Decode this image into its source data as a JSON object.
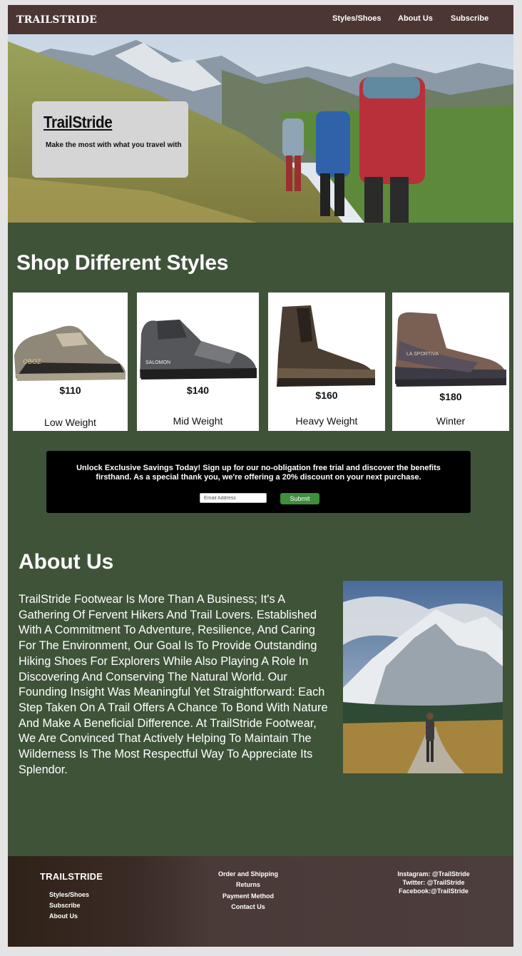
{
  "nav": {
    "logo": "TRAILSTRIDE",
    "links": [
      "Styles/Shoes",
      "About Us",
      "Subscribe"
    ]
  },
  "hero": {
    "title": "TrailStride",
    "subtitle": "Make the most with what you travel with"
  },
  "styles": {
    "title": "Shop Different Styles",
    "cards": [
      {
        "price": "$110",
        "name": "Low Weight"
      },
      {
        "price": "$140",
        "name": "Mid Weight"
      },
      {
        "price": "$160",
        "name": "Heavy Weight"
      },
      {
        "price": "$180",
        "name": "Winter"
      }
    ]
  },
  "promo": {
    "text": "Unlock Exclusive Savings Today! Sign up for our no-obligation free trial and discover the benefits firsthand. As a special thank you, we're offering a 20% discount on your next purchase.",
    "email_placeholder": "Email Address",
    "submit_label": "Submit"
  },
  "about": {
    "title": "About Us",
    "body": "TrailStride Footwear Is More Than A Business; It's A Gathering Of Fervent Hikers And Trail Lovers. Established With A Commitment To Adventure, Resilience, And Caring For The Environment, Our Goal Is To Provide Outstanding Hiking Shoes For Explorers While Also Playing A Role In Discovering And Conserving The Natural World. Our Founding Insight Was Meaningful Yet Straightforward: Each Step Taken On A Trail Offers A Chance To Bond With Nature And Make A Beneficial Difference. At TrailStride Footwear, We Are Convinced That Actively Helping To Maintain The Wilderness Is The Most Respectful Way To Appreciate Its Splendor."
  },
  "footer": {
    "logo": "TRAILSTRIDE",
    "nav_links": [
      "Styles/Shoes",
      "Subscribe",
      "About Us"
    ],
    "info_links": [
      "Order and Shipping",
      "Returns",
      "Payment Method",
      "Contact Us"
    ],
    "social": [
      "Instagram: @TrailStride",
      "Twitter: @TrailStride",
      "Facebook:@TrailStride"
    ]
  },
  "colors": {
    "nav_bg": "#4c3634",
    "page_bg": "#3f5339",
    "submit_green": "#3e8e3e"
  }
}
